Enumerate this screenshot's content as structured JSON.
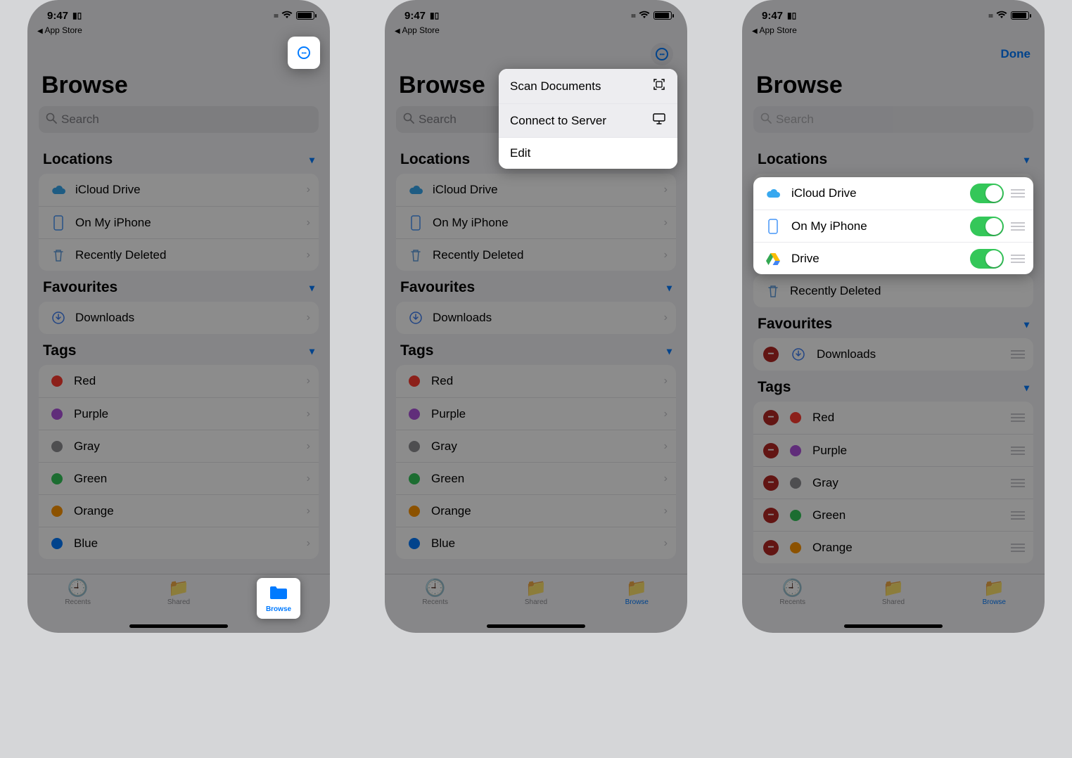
{
  "status": {
    "time": "9:47",
    "back": "App Store"
  },
  "header": {
    "title": "Browse",
    "done": "Done"
  },
  "search": {
    "placeholder": "Search"
  },
  "sections": {
    "locations": "Locations",
    "favourites": "Favourites",
    "tags": "Tags"
  },
  "locations": [
    {
      "label": "iCloud Drive"
    },
    {
      "label": "On My iPhone"
    },
    {
      "label": "Recently Deleted"
    }
  ],
  "edit_locations": [
    {
      "label": "iCloud Drive"
    },
    {
      "label": "On My iPhone"
    },
    {
      "label": "Drive"
    }
  ],
  "recently_deleted": "Recently Deleted",
  "favourites": [
    {
      "label": "Downloads"
    }
  ],
  "tags": [
    {
      "label": "Red",
      "color": "#ff3b30"
    },
    {
      "label": "Purple",
      "color": "#af52de"
    },
    {
      "label": "Gray",
      "color": "#8e8e93"
    },
    {
      "label": "Green",
      "color": "#34c759"
    },
    {
      "label": "Orange",
      "color": "#ff9500"
    },
    {
      "label": "Blue",
      "color": "#007aff"
    }
  ],
  "tags_edit": [
    {
      "label": "Red",
      "color": "#ff3b30"
    },
    {
      "label": "Purple",
      "color": "#af52de"
    },
    {
      "label": "Gray",
      "color": "#8e8e93"
    },
    {
      "label": "Green",
      "color": "#34c759"
    },
    {
      "label": "Orange",
      "color": "#ff9500"
    }
  ],
  "menu": {
    "scan": "Scan Documents",
    "connect": "Connect to Server",
    "edit": "Edit"
  },
  "tabs": {
    "recents": "Recents",
    "shared": "Shared",
    "browse": "Browse"
  }
}
